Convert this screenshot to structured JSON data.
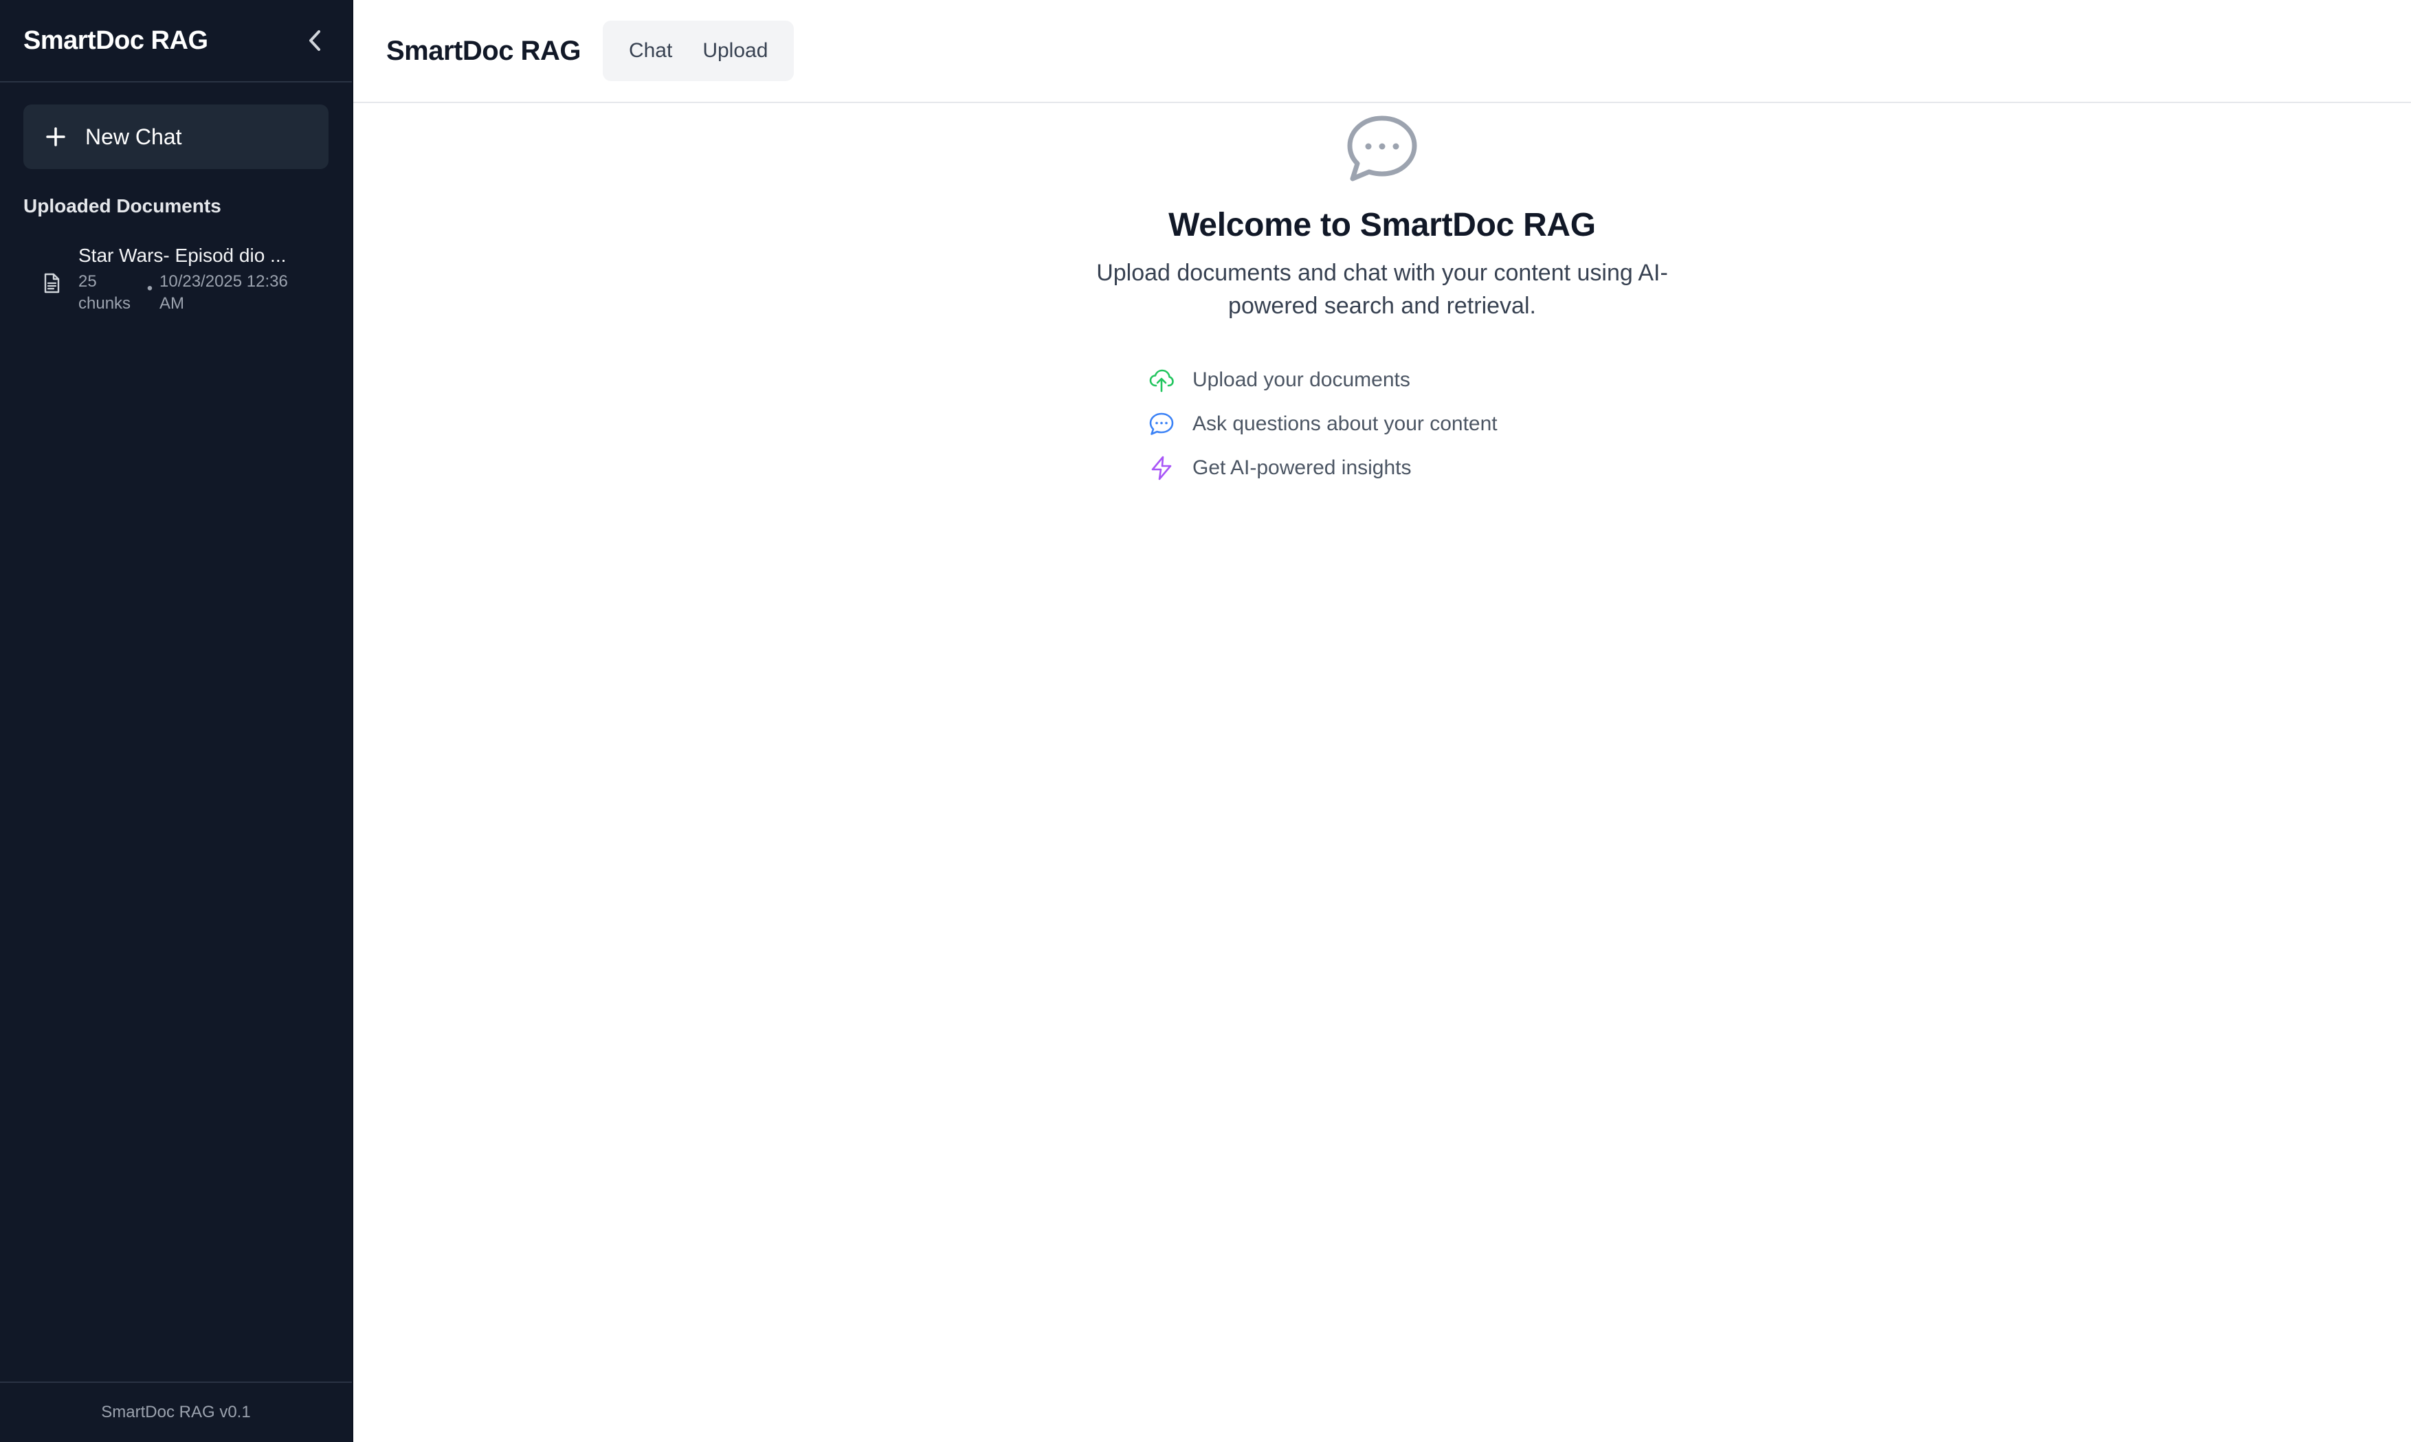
{
  "sidebar": {
    "title": "SmartDoc RAG",
    "new_chat_label": "New Chat",
    "section_title": "Uploaded Documents",
    "documents": [
      {
        "name": "Star Wars- Episoḋ dio ...",
        "chunks": "25 chunks",
        "separator": "•",
        "date": "10/23/2025 12:36 AM"
      }
    ],
    "footer": "SmartDoc RAG v0.1"
  },
  "header": {
    "title": "SmartDoc RAG",
    "tabs": [
      {
        "label": "Chat"
      },
      {
        "label": "Upload"
      }
    ]
  },
  "welcome": {
    "title": "Welcome to SmartDoc RAG",
    "subtitle": "Upload documents and chat with your content using AI-powered search and retrieval.",
    "features": [
      {
        "label": "Upload your documents",
        "icon": "cloud-upload-icon",
        "color": "#22c55e"
      },
      {
        "label": "Ask questions about your content",
        "icon": "chat-bubble-icon",
        "color": "#3b82f6"
      },
      {
        "label": "Get AI-powered insights",
        "icon": "lightning-icon",
        "color": "#a855f7"
      }
    ]
  },
  "colors": {
    "sidebar_bg": "#111827",
    "new_chat_bg": "#1f2937",
    "tabs_bg": "#f3f4f6",
    "icon_gray": "#9ca3af"
  }
}
